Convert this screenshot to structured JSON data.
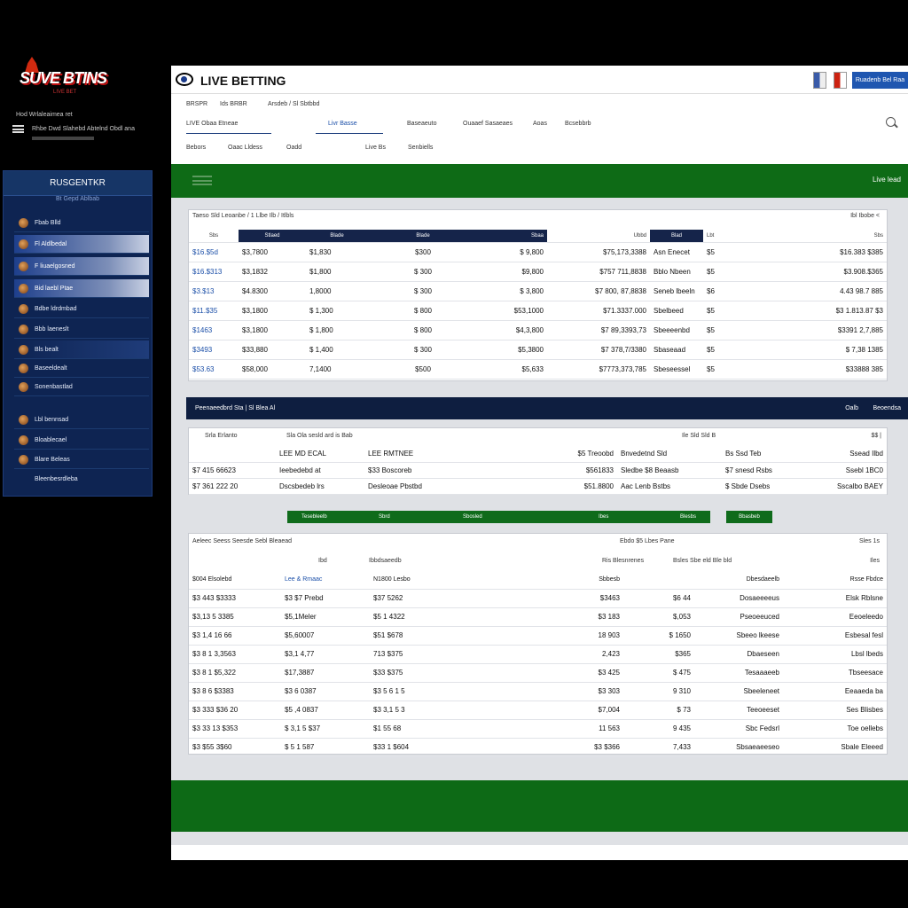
{
  "brand": {
    "logo": "SUVE BTINS",
    "tagline": "LIVE BET",
    "line1": "Hod Wrlaleaimea ret",
    "line2": "Rhbe Dwd Slahebd Abtelnd Obdl ana"
  },
  "colors": {
    "navy": "#15244a",
    "green": "#0e6b16",
    "blue": "#1f56b0",
    "panel": "#0e2452"
  },
  "panel": {
    "title": "RUSGENTKR",
    "subtitle": "Bt Gepd  Ablbab",
    "items": [
      "Fbab Blld",
      "Fl Aldlbedal",
      "F liuaelgosned",
      "Bid laebl Ptae",
      "Bdbe ldrdmbad",
      "Bbb laeneslt",
      "Bls bealt",
      "Baseeldealt",
      "Sonenbastlad",
      "Lbl bennsad",
      "Bloablecael",
      "Blare Beleas",
      "Bleenbesrdleba"
    ]
  },
  "header": {
    "title": "LIVE BETTING",
    "button": "Ruadenb Bel Raa",
    "nav_row1": [
      "BRSPR",
      "Ids BRBR",
      "Arsdeb / Sl Sbtbbd"
    ],
    "nav_row2": [
      "LIVE Obaa Etneae",
      "Livr Basse",
      "Baseaeuto",
      "Ouaaef Sasaeaes",
      "Aoas",
      "Bcsebbrb"
    ],
    "nav_row3": [
      "Bebors",
      "Oaac Lldess",
      "Oadd",
      "Live Bs",
      "Senbiells"
    ],
    "green_label": "Live lead"
  },
  "table1": {
    "caption": "Taeso Sld Leoanbe / 1  Llbe Ilb / Itlbls",
    "caption_right": "Ibl Ibobe  <",
    "headers": [
      "Sbs",
      "Stlaed",
      "Blade",
      "Blade",
      "Sbaa",
      "Ubbd",
      "Blad",
      "Lbt",
      "Sbs"
    ],
    "rows": [
      [
        "$16.$5d",
        "$3,7800",
        "$1,830",
        "$300",
        "$ 9,800",
        "$75,173,3388",
        "Asn Enecet",
        "$5",
        "$16.383 $385"
      ],
      [
        "$16.$313",
        "$3,1832",
        "$1,800",
        "$ 300",
        "$9,800",
        "$757 711,8838",
        "Bblo Nbeen",
        "$5",
        "$3.908.$365"
      ],
      [
        "$3.$13",
        "$4.8300",
        "1,8000",
        "$ 300",
        "$ 3,800",
        "$7 800, 87,8838",
        "Seneb lbeeln",
        "$6",
        "4.43 98.7 885"
      ],
      [
        "$11.$35",
        "$3,1800",
        "$ 1,300",
        "$ 800",
        "$53,1000",
        "$71.3337.000",
        "Sbelbeed",
        "$5",
        "$3 1.813.87 $3"
      ],
      [
        "$1463",
        "$3,1800",
        "$ 1,800",
        "$ 800",
        "$4,3,800",
        "$7 89,3393,73",
        "Sbeeeenbd",
        "$5",
        "$3391 2,7,885"
      ],
      [
        "$3493",
        "$33,880",
        "$ 1,400",
        "$ 300",
        "$5,3800",
        "$7 378,7/3380",
        "Sbaseaad",
        "$5",
        "$ 7,38 1385"
      ],
      [
        "$53.63",
        "$58,000",
        "7,1400",
        "$500",
        "$5,633",
        "$7773,373,785",
        "Sbeseessel",
        "$5",
        "$33888 385"
      ]
    ]
  },
  "bar": {
    "left": "Peenaeedbrd Sta | Sl Blea Al",
    "right1": "Oalb",
    "right2": "Beoendsa"
  },
  "table2": {
    "caption": "Srla Erlanto",
    "caption_mid": "Sla  Ola  sesld ard is  Bab",
    "caption_right": "Ile Sld Sld B",
    "caption_far": "$$ |",
    "headers": [
      "LEE MD ECAL",
      "LEE RMTNEE",
      "$5 Treoobd",
      "Bnvedetnd Sld",
      "Bs Ssd Teb",
      "Ssead Ilbd"
    ],
    "rows": [
      [
        "$7 415 66623",
        "Ieebedebd at",
        "$33 Boscoreb",
        "$561833",
        "Sledbe  $8 Beaasb",
        "$7  snesd  Rsbs",
        "Ssebl  1BC0"
      ],
      [
        "$7 361 222 20",
        "Dscsbedeb lrs",
        "Desleoae Pbstbd",
        "$51.8800",
        "Aac Lenb Bstbs",
        "$ Sbde Dsebs",
        "Sscalbo  BAEY"
      ]
    ]
  },
  "pills": [
    "Tesebleelb",
    "Sbrd",
    "Sbosled",
    "Ibes",
    "Blesbs",
    "Bbasbeb"
  ],
  "table3": {
    "caption": "Aeleec Seess  Seesde Sebl Bleaead",
    "caption_mid": "Ebdo  $5  Lbes Pane",
    "caption_right": "Sles 1s",
    "sub_headers": [
      "Ibd",
      "Ibbdsaeedb",
      "Ris Blesnrenes",
      "Bsles  Sbe eld Ble bld",
      "Iles"
    ],
    "headers": [
      "$004 Elsolebd",
      "Lee & Rmaac",
      "N1800 Lesbo",
      "Sbbesb",
      "Dbesdaeelb",
      "Rsse Fbdce"
    ],
    "rows": [
      [
        "$3 443 $3333",
        "$3 $7 Prebd",
        "$37 5262",
        "$3463",
        "$6 44",
        "Dosaeeeeus",
        "Elsk Rblsne"
      ],
      [
        "$3,13 5 3385",
        "$5,1Meler",
        "$5 1 4322",
        "$3 183",
        "$,053",
        "Pseoeeuced",
        "Eeoeleedo"
      ],
      [
        "$3 1,4 16 66",
        "$5,60007",
        "$51 $678",
        "18 903",
        "$ 1650",
        "Sbeeo lkeese",
        "Esbesal fesl"
      ],
      [
        "$3 8 1 3,3563",
        "$3,1 4,77",
        "713 $375",
        "2,423",
        "$365",
        "Dbaeseen",
        "Lbsl lbeds"
      ],
      [
        "$3 8 1 $5,322",
        "$17,3887",
        "$33 $375",
        "$3 425",
        "$ 475",
        "Tesaaaeeb",
        "Tbseesace"
      ],
      [
        "$3 8 6 $3383",
        "$3 6 0387",
        "$3 5 6 1 5",
        "$3 303",
        "9 310",
        "Sbeeleneet",
        "Eeaaeda ba"
      ],
      [
        "$3 333 $36 20",
        "$5 ,4 0837",
        "$3 3,1 5 3",
        "$7,004",
        "$ 73",
        "Teeoeeset",
        "Ses Blisbes"
      ],
      [
        "$3 33 13 $353",
        "$ 3,1 5 $37",
        "$1 55 68",
        "11 563",
        "9 435",
        "Sbc Fedsrl",
        "Toe oellebs"
      ],
      [
        "$3 $55 3$60",
        "$ 5 1 587",
        "$33 1 $604",
        "$3 $366",
        "7,433",
        "Sbsaeaeeseo",
        "Sbale Eleeed"
      ]
    ]
  }
}
